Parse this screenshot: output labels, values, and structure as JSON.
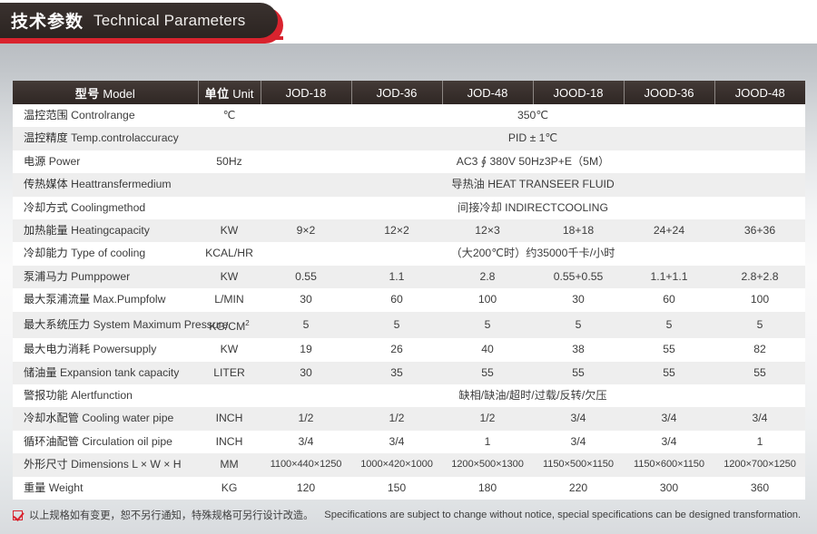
{
  "banner": {
    "title_cn": "技术参数",
    "title_en": "Technical Parameters"
  },
  "table": {
    "headers": [
      {
        "cn": "型号",
        "en": "Model"
      },
      {
        "cn": "单位",
        "en": "Unit"
      },
      {
        "cn": "",
        "en": "JOD-18"
      },
      {
        "cn": "",
        "en": "JOD-36"
      },
      {
        "cn": "",
        "en": "JOD-48"
      },
      {
        "cn": "",
        "en": "JOOD-18"
      },
      {
        "cn": "",
        "en": "JOOD-36"
      },
      {
        "cn": "",
        "en": "JOOD-48"
      }
    ],
    "rows": [
      {
        "label_cn": "温控范围",
        "label_en": "Controlrange",
        "unit": "℃",
        "merged": true,
        "merged_value": "350℃"
      },
      {
        "label_cn": "温控精度",
        "label_en": "Temp.controlaccuracy",
        "unit": "",
        "merged": true,
        "merged_value": "PID ± 1℃"
      },
      {
        "label_cn": "电源",
        "label_en": "Power",
        "unit": "50Hz",
        "merged": true,
        "merged_value": "AC3 ∮ 380V 50Hz3P+E（5M）"
      },
      {
        "label_cn": "传热媒体",
        "label_en": "Heattransfermedium",
        "unit": "",
        "merged": true,
        "merged_value": "导热油 HEAT TRANSEER FLUID"
      },
      {
        "label_cn": "冷却方式",
        "label_en": "Coolingmethod",
        "unit": "",
        "merged": true,
        "merged_value": "间接冷却 INDIRECTCOOLING"
      },
      {
        "label_cn": "加热能量",
        "label_en": "Heatingcapacity",
        "unit": "KW",
        "merged": false,
        "values": [
          "9×2",
          "12×2",
          "12×3",
          "18+18",
          "24+24",
          "36+36"
        ]
      },
      {
        "label_cn": "冷却能力",
        "label_en": "Type of cooling",
        "unit": "KCAL/HR",
        "merged": true,
        "merged_value": "（大200℃时）约35000千卡/小时"
      },
      {
        "label_cn": "泵浦马力",
        "label_en": "Pumppower",
        "unit": "KW",
        "merged": false,
        "values": [
          "0.55",
          "1.1",
          "2.8",
          "0.55+0.55",
          "1.1+1.1",
          "2.8+2.8"
        ]
      },
      {
        "label_cn": "最大泵浦流量",
        "label_en": "Max.Pumpfolw",
        "unit": "L/MIN",
        "merged": false,
        "values": [
          "30",
          "60",
          "100",
          "30",
          "60",
          "100"
        ]
      },
      {
        "label_cn": "最大系统压力",
        "label_en": "System Maximum Pressure",
        "unit": "KG/CM2",
        "unit_sup": "2",
        "unit_base": "KG/CM",
        "merged": false,
        "values": [
          "5",
          "5",
          "5",
          "5",
          "5",
          "5"
        ]
      },
      {
        "label_cn": "最大电力消耗",
        "label_en": "Powersupply",
        "unit": "KW",
        "merged": false,
        "values": [
          "19",
          "26",
          "40",
          "38",
          "55",
          "82"
        ]
      },
      {
        "label_cn": "储油量",
        "label_en": "Expansion tank capacity",
        "unit": "LITER",
        "merged": false,
        "values": [
          "30",
          "35",
          "55",
          "55",
          "55",
          "55"
        ]
      },
      {
        "label_cn": "警报功能",
        "label_en": "Alertfunction",
        "unit": "",
        "merged": true,
        "merged_value": "缺相/缺油/超时/过载/反转/欠压"
      },
      {
        "label_cn": "冷却水配管",
        "label_en": "Cooling water pipe",
        "unit": "INCH",
        "merged": false,
        "values": [
          "1/2",
          "1/2",
          "1/2",
          "3/4",
          "3/4",
          "3/4"
        ]
      },
      {
        "label_cn": "循环油配管",
        "label_en": "Circulation oil pipe",
        "unit": "INCH",
        "merged": false,
        "values": [
          "3/4",
          "3/4",
          "1",
          "3/4",
          "3/4",
          "1"
        ]
      },
      {
        "label_cn": "外形尺寸",
        "label_en": "Dimensions L × W × H",
        "unit": "MM",
        "merged": false,
        "dims": true,
        "values": [
          "1100×440×1250",
          "1000×420×1000",
          "1200×500×1300",
          "1150×500×1150",
          "1150×600×1150",
          "1200×700×1250"
        ]
      },
      {
        "label_cn": "重量",
        "label_en": "Weight",
        "unit": "KG",
        "merged": false,
        "values": [
          "120",
          "150",
          "180",
          "220",
          "300",
          "360"
        ]
      }
    ]
  },
  "footnote": {
    "cn": "以上规格如有变更，恕不另行通知，特殊规格可另行设计改造。",
    "en": "Specifications are subject to change without notice, special specifications can be designed transformation."
  },
  "colors": {
    "accent_red": "#d9232e",
    "header_dark": "#3a312e",
    "row_alt": "#eeeeee"
  }
}
